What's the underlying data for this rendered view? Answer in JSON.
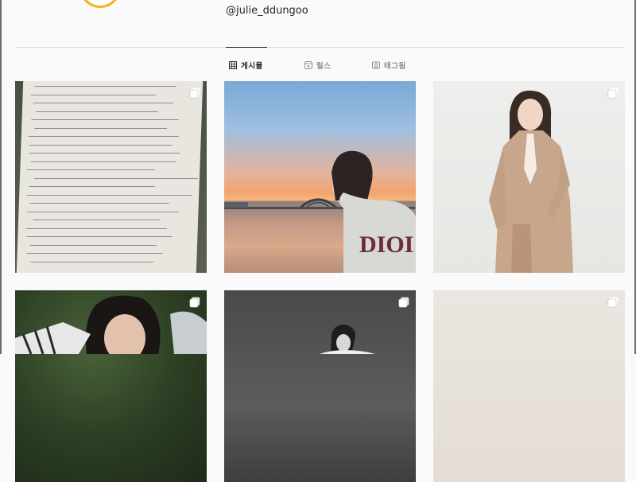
{
  "profile": {
    "handle": "@julie_ddungoo"
  },
  "tabs": [
    {
      "label": "게시물",
      "icon": "grid-icon",
      "active": true
    },
    {
      "label": "릴스",
      "icon": "reels-icon",
      "active": false
    },
    {
      "label": "태그됨",
      "icon": "tagged-icon",
      "active": false
    }
  ],
  "posts": [
    {
      "kind": "handwritten-letter",
      "multi": true
    },
    {
      "kind": "sunset-selfie",
      "multi": false
    },
    {
      "kind": "beige-suit-portrait",
      "multi": true
    },
    {
      "kind": "grass-portrait",
      "multi": true
    },
    {
      "kind": "black-white-photo",
      "multi": true
    },
    {
      "kind": "beige-studio-photo",
      "multi": true
    }
  ],
  "colors": {
    "background": "#fafafa",
    "text": "#262626",
    "muted": "#8e8e8e",
    "divider": "#dbdbdb",
    "story_ring": "#f2b21e"
  }
}
